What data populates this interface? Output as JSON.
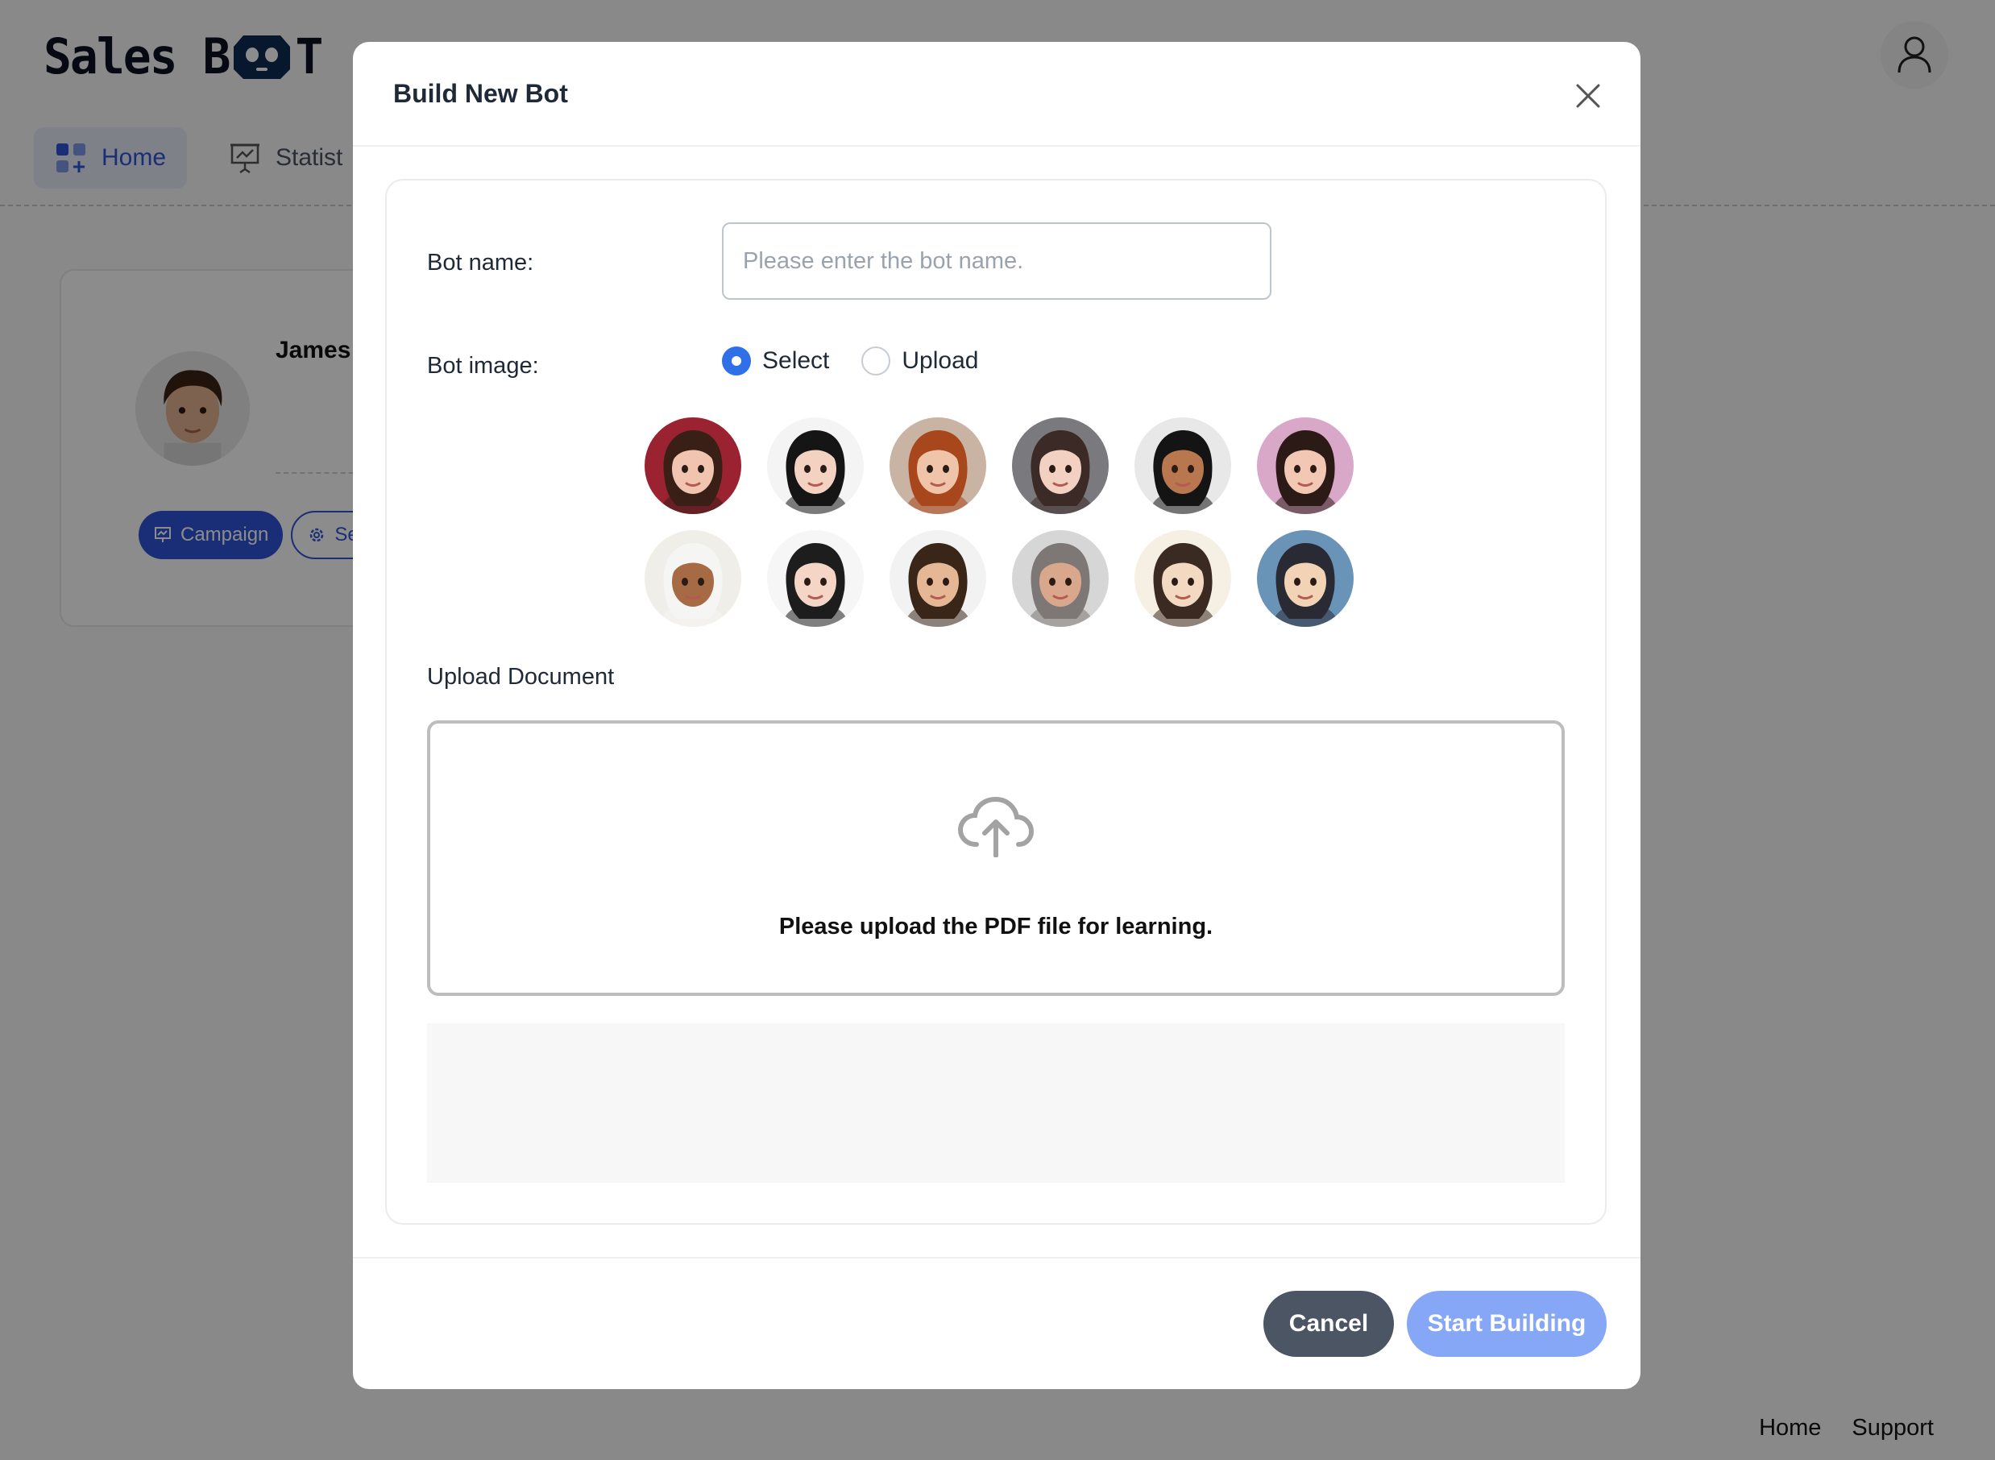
{
  "app": {
    "logo_text_left": "Sales B",
    "logo_text_right": "T"
  },
  "nav": {
    "items": [
      {
        "label": "Home",
        "icon": "dashboard-icon"
      },
      {
        "label": "Statist",
        "icon": "presentation-chart-icon"
      }
    ]
  },
  "background_card": {
    "name": "James",
    "campaign_label": "Campaign",
    "settings_label": "Set"
  },
  "footer": {
    "links": [
      "Home",
      "Support"
    ]
  },
  "modal": {
    "title": "Build New Bot",
    "bot_name_label": "Bot name:",
    "bot_name_placeholder": "Please enter the bot name.",
    "bot_name_value": "",
    "bot_image_label": "Bot image:",
    "radio_options": [
      {
        "label": "Select",
        "checked": true
      },
      {
        "label": "Upload",
        "checked": false
      }
    ],
    "avatars": [
      {
        "name": "avatar-brunette-woman",
        "bg": "#9b2331",
        "skin": "#f1c4b0",
        "hair": "#3a1f17"
      },
      {
        "name": "avatar-black-hair-woman",
        "bg": "#f4f4f4",
        "skin": "#f3d2c1",
        "hair": "#151515"
      },
      {
        "name": "avatar-redhead-woman",
        "bg": "#c9b3a3",
        "skin": "#f0c4a8",
        "hair": "#a8461c"
      },
      {
        "name": "avatar-glasses-woman",
        "bg": "#7a7a7e",
        "skin": "#f2d1c2",
        "hair": "#3b2a25"
      },
      {
        "name": "avatar-dark-skin-woman",
        "bg": "#e8e8e8",
        "skin": "#b9774f",
        "hair": "#141414"
      },
      {
        "name": "avatar-bun-woman",
        "bg": "#d9a8c8",
        "skin": "#f2c8b5",
        "hair": "#2c1a16"
      },
      {
        "name": "avatar-headscarf-woman",
        "bg": "#f0eee9",
        "skin": "#a66a45",
        "hair": "#f5f5f3"
      },
      {
        "name": "avatar-long-hair-woman",
        "bg": "#f6f6f6",
        "skin": "#f4d5c6",
        "hair": "#1d1d1d"
      },
      {
        "name": "avatar-young-man",
        "bg": "#f2f2f2",
        "skin": "#e6b795",
        "hair": "#3a2519"
      },
      {
        "name": "avatar-older-man",
        "bg": "#d6d6d6",
        "skin": "#d9a88c",
        "hair": "#7d7875"
      },
      {
        "name": "avatar-bob-hair-woman",
        "bg": "#f6efe3",
        "skin": "#f4d9c2",
        "hair": "#3a2a22"
      },
      {
        "name": "avatar-anime-boy",
        "bg": "#6a93b8",
        "skin": "#f3d3b5",
        "hair": "#2a2a35"
      }
    ],
    "upload_section_label": "Upload Document",
    "upload_hint": "Please upload the PDF file for learning.",
    "cancel_label": "Cancel",
    "start_label": "Start Building"
  },
  "colors": {
    "primary": "#2f54d7",
    "radio_accent": "#2f6fe8",
    "start_button": "#86a7f5",
    "cancel_button": "#4b5563"
  }
}
